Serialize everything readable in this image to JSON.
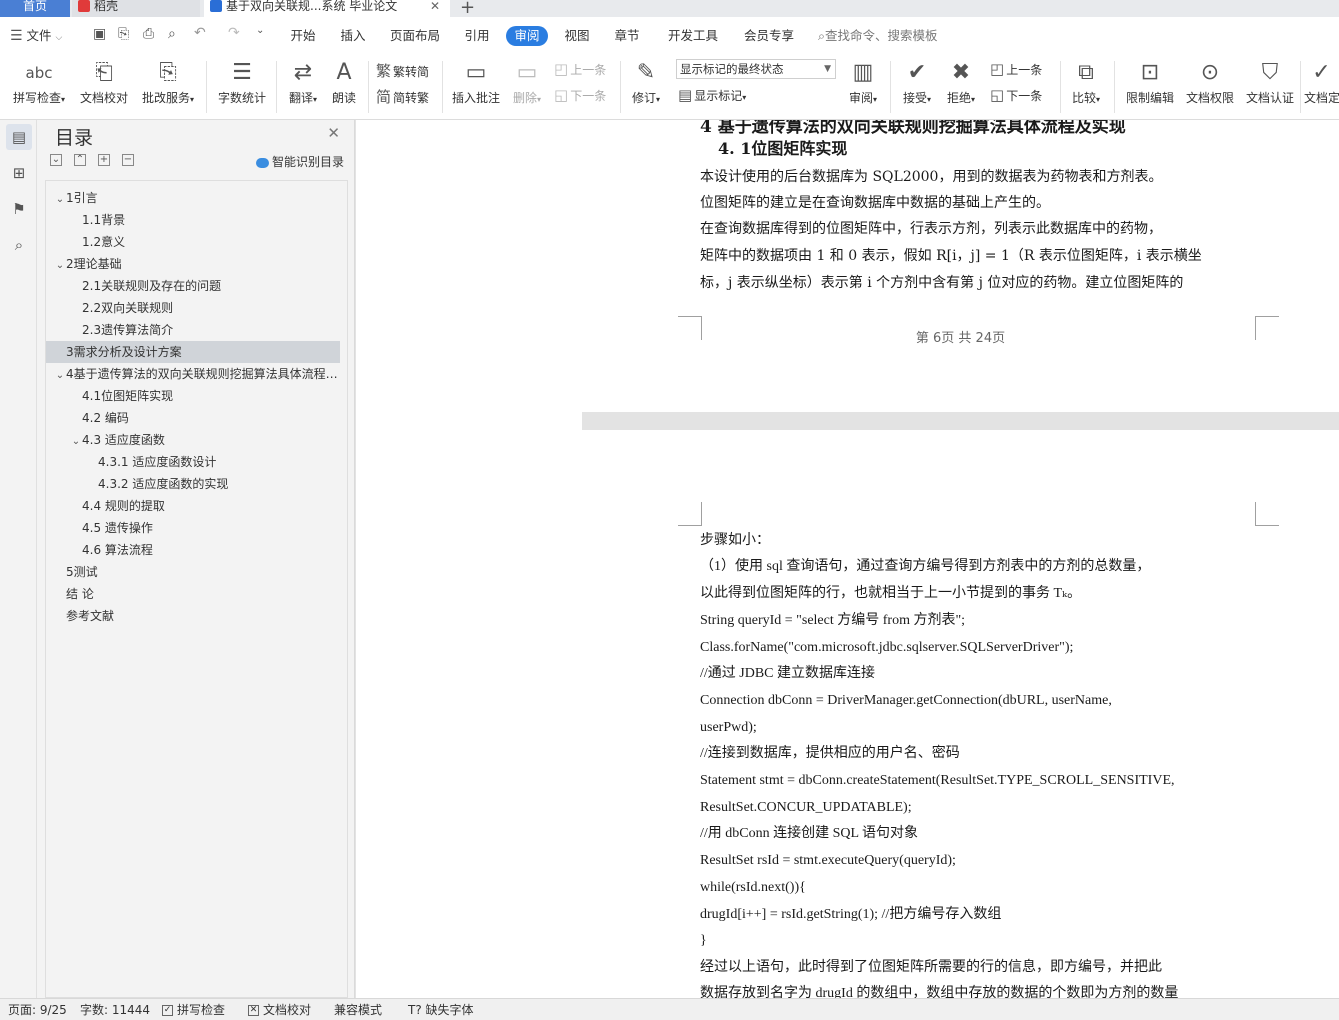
{
  "tabs": {
    "home": "首页",
    "shell": "稻壳",
    "doc": "基于双向关联规...系统 毕业论文",
    "add": "+"
  },
  "menu": {
    "file": "文件",
    "items": [
      "开始",
      "插入",
      "页面布局",
      "引用",
      "审阅",
      "视图",
      "章节",
      "开发工具",
      "会员专享"
    ],
    "active": "审阅",
    "search_placeholder": "查找命令、搜索模板"
  },
  "ribbon": {
    "spell": "拼写检查",
    "spell_icon_text": "abc",
    "proof": "文档校对",
    "revise_service": "批改服务",
    "word_count": "字数统计",
    "translate": "翻译",
    "read_aloud": "朗读",
    "trad": "繁转简",
    "simp": "简转繁",
    "insert_comment": "插入批注",
    "delete": "删除",
    "prev_comment": "上一条",
    "next_comment": "下一条",
    "track": "修订",
    "markup_select": "显示标记的最终状态",
    "show_markup": "显示标记",
    "review": "审阅",
    "accept": "接受",
    "reject": "拒绝",
    "prev_change": "上一条",
    "next_change": "下一条",
    "compare": "比较",
    "restrict": "限制编辑",
    "permission": "文档权限",
    "certify": "文档认证",
    "last": "文档定"
  },
  "toc": {
    "title": "目录",
    "smart": "智能识别目录",
    "items": [
      {
        "label": "1引言",
        "level": 1,
        "caret": "⌄"
      },
      {
        "label": "1.1背景",
        "level": 2,
        "caret": ""
      },
      {
        "label": "1.2意义",
        "level": 2,
        "caret": ""
      },
      {
        "label": "2理论基础",
        "level": 1,
        "caret": "⌄"
      },
      {
        "label": "2.1关联规则及存在的问题",
        "level": 2,
        "caret": ""
      },
      {
        "label": "2.2双向关联规则",
        "level": 2,
        "caret": ""
      },
      {
        "label": "2.3遗传算法简介",
        "level": 2,
        "caret": ""
      },
      {
        "label": "3需求分析及设计方案",
        "level": 1,
        "caret": "",
        "selected": true
      },
      {
        "label": "4基于遗传算法的双向关联规则挖掘算法具体流程及实现",
        "level": 1,
        "caret": "⌄"
      },
      {
        "label": "4.1位图矩阵实现",
        "level": 2,
        "caret": ""
      },
      {
        "label": "4.2  编码",
        "level": 2,
        "caret": ""
      },
      {
        "label": "4.3  适应度函数",
        "level": 2,
        "caret": "⌄"
      },
      {
        "label": "4.3.1  适应度函数设计",
        "level": 3,
        "caret": ""
      },
      {
        "label": "4.3.2  适应度函数的实现",
        "level": 3,
        "caret": ""
      },
      {
        "label": "4.4  规则的提取",
        "level": 2,
        "caret": ""
      },
      {
        "label": "4.5  遗传操作",
        "level": 2,
        "caret": ""
      },
      {
        "label": "4.6  算法流程",
        "level": 2,
        "caret": ""
      },
      {
        "label": "5测试",
        "level": 1,
        "caret": ""
      },
      {
        "label": "结      论",
        "level": 1,
        "caret": ""
      },
      {
        "label": "参考文献",
        "level": 1,
        "caret": ""
      }
    ]
  },
  "page1": {
    "heading1": "4   基于遗传算法的双向关联规则挖掘算法具体流程及实现",
    "heading2": "4. 1位图矩阵实现",
    "lines": [
      "        本设计使用的后台数据库为 SQL2000，用到的数据表为药物表和方剂表。",
      "位图矩阵的建立是在查询数据库中数据的基础上产生的。",
      "        在查询数据库得到的位图矩阵中，行表示方剂，列表示此数据库中的药物，",
      "矩阵中的数据项由 1 和 0 表示，假如 R[i，j] = 1（R 表示位图矩阵，i 表示横坐",
      "标，j 表示纵坐标）表示第 i 个方剂中含有第 j 位对应的药物。建立位图矩阵的"
    ],
    "footer": "第 6页  共 24页"
  },
  "page2": {
    "lines": [
      "步骤如小：",
      "        （1）使用 sql 查询语句，通过查询方编号得到方剂表中的方剂的总数量，",
      "以此得到位图矩阵的行，也就相当于上一小节提到的事务 Tₖ。",
      "        String queryId = \"select  方编号  from    方剂表\";",
      "        Class.forName(\"com.microsoft.jdbc.sqlserver.SQLServerDriver\");",
      "        //通过  JDBC 建立数据库连接",
      "        Connection    dbConn    =    DriverManager.getConnection(dbURL,    userName,",
      "userPwd);",
      "        //连接到数据库，提供相应的用户名、密码",
      "Statement   stmt   =   dbConn.createStatement(ResultSet.TYPE_SCROLL_SENSITIVE,",
      "ResultSet.CONCUR_UPDATABLE);",
      "        //用 dbConn 连接创建 SQL 语句对象",
      "        ResultSet rsId = stmt.executeQuery(queryId);",
      "        while(rsId.next()){",
      "                    drugId[i++] = rsId.getString(1);                //把方编号存入数组",
      "        }",
      "        经过以上语句，此时得到了位图矩阵所需要的行的信息，即方编号，并把此",
      "数据存放到名字为 drugId 的数组中，数组中存放的数据的个数即为方剂的数量"
    ]
  },
  "status": {
    "page": "页面: 9/25",
    "words": "字数: 11444",
    "spell": "拼写检查",
    "proof": "文档校对",
    "compat": "兼容模式",
    "font_missing": "缺失字体"
  },
  "colors": {
    "accent": "#2a7de1",
    "home_tab": "#4a7fd4",
    "selection": "#d0d4d9"
  }
}
